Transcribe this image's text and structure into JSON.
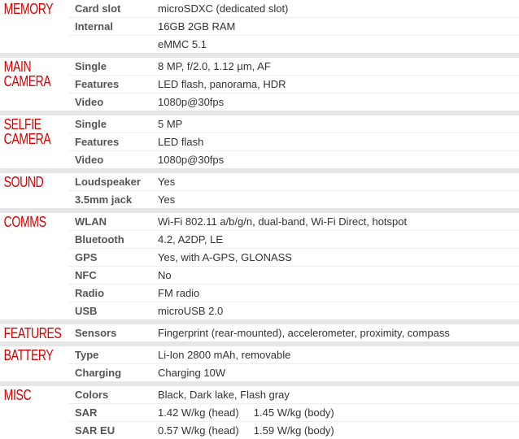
{
  "groups": [
    {
      "label": "MEMORY",
      "rows": [
        {
          "key": "Card slot",
          "value": "microSDXC (dedicated slot)"
        },
        {
          "key": "Internal",
          "value": "16GB 2GB RAM"
        },
        {
          "key": "",
          "value": "eMMC 5.1"
        }
      ]
    },
    {
      "label": "MAIN\nCAMERA",
      "rows": [
        {
          "key": "Single",
          "value": "8 MP, f/2.0, 1.12 µm, AF"
        },
        {
          "key": "Features",
          "value": "LED flash, panorama, HDR"
        },
        {
          "key": "Video",
          "value": "1080p@30fps"
        }
      ]
    },
    {
      "label": "SELFIE\nCAMERA",
      "rows": [
        {
          "key": "Single",
          "value": "5 MP"
        },
        {
          "key": "Features",
          "value": "LED flash"
        },
        {
          "key": "Video",
          "value": "1080p@30fps"
        }
      ]
    },
    {
      "label": "SOUND",
      "rows": [
        {
          "key": "Loudspeaker",
          "value": "Yes"
        },
        {
          "key": "3.5mm jack",
          "value": "Yes"
        }
      ]
    },
    {
      "label": "COMMS",
      "rows": [
        {
          "key": "WLAN",
          "value": "Wi-Fi 802.11 a/b/g/n, dual-band, Wi-Fi Direct, hotspot"
        },
        {
          "key": "Bluetooth",
          "value": "4.2, A2DP, LE"
        },
        {
          "key": "GPS",
          "value": "Yes, with A-GPS, GLONASS"
        },
        {
          "key": "NFC",
          "value": "No"
        },
        {
          "key": "Radio",
          "value": "FM radio"
        },
        {
          "key": "USB",
          "value": "microUSB 2.0"
        }
      ]
    },
    {
      "label": "FEATURES",
      "rows": [
        {
          "key": "Sensors",
          "value": "Fingerprint (rear-mounted), accelerometer, proximity, compass"
        }
      ]
    },
    {
      "label": "BATTERY",
      "rows": [
        {
          "key": "Type",
          "value": "Li-Ion 2800 mAh, removable"
        },
        {
          "key": "Charging",
          "value": "Charging 10W"
        }
      ]
    },
    {
      "label": "MISC",
      "rows": [
        {
          "key": "Colors",
          "value": "Black, Dark lake, Flash gray"
        },
        {
          "key": "SAR",
          "value": "1.42 W/kg (head)     1.45 W/kg (body)"
        },
        {
          "key": "SAR EU",
          "value": "0.57 W/kg (head)     1.59 W/kg (body)"
        }
      ]
    }
  ]
}
